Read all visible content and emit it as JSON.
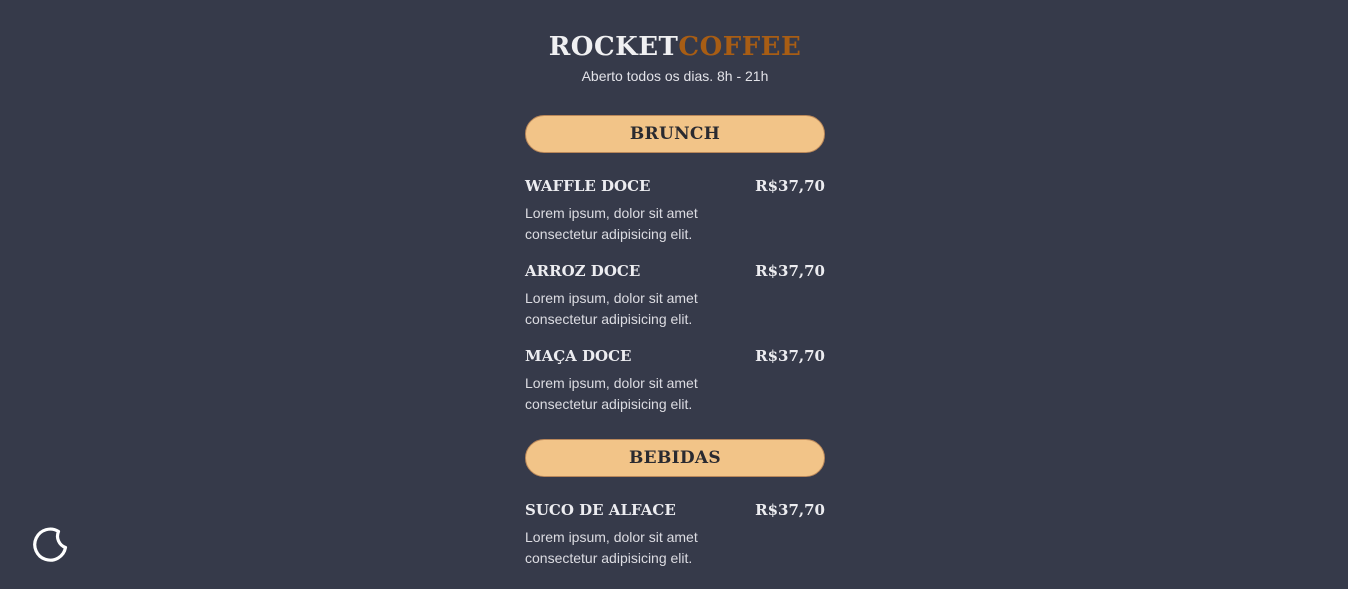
{
  "header": {
    "brand_part1": "ROCKET",
    "brand_part2": "COFFEE",
    "subtitle": "Aberto todos os dias. 8h - 21h"
  },
  "sections": [
    {
      "label": "BRUNCH",
      "items": [
        {
          "name": "WAFFLE DOCE",
          "price": "R$37,70",
          "description": "Lorem ipsum, dolor sit amet consectetur adipisicing elit."
        },
        {
          "name": "ARROZ DOCE",
          "price": "R$37,70",
          "description": "Lorem ipsum, dolor sit amet consectetur adipisicing elit."
        },
        {
          "name": "MAÇA DOCE",
          "price": "R$37,70",
          "description": "Lorem ipsum, dolor sit amet consectetur adipisicing elit."
        }
      ]
    },
    {
      "label": "BEBIDAS",
      "items": [
        {
          "name": "SUCO DE ALFACE",
          "price": "R$37,70",
          "description": "Lorem ipsum, dolor sit amet consectetur adipisicing elit."
        }
      ]
    }
  ],
  "theme_toggle": {
    "icon": "moon-icon"
  },
  "colors": {
    "background": "#363a4a",
    "accent": "#a85d14",
    "section_button": "#f2c488"
  }
}
